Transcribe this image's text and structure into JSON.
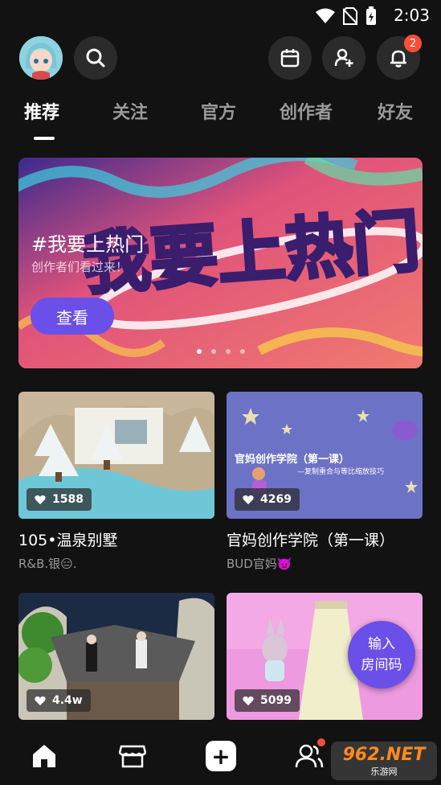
{
  "status_bar": {
    "time": "2:03"
  },
  "header": {
    "notification_count": "2"
  },
  "tabs": [
    {
      "label": "推荐",
      "active": true
    },
    {
      "label": "关注",
      "active": false
    },
    {
      "label": "官方",
      "active": false
    },
    {
      "label": "创作者",
      "active": false
    },
    {
      "label": "好友",
      "active": false
    }
  ],
  "banner": {
    "title": "#我要上热门",
    "subtitle": "创作者们看过来！",
    "button_label": "查看",
    "art_text": "我要上热门",
    "page_count": 4,
    "active_page": 1
  },
  "cards": [
    {
      "title": "105•温泉别墅",
      "author": "R&B.银😑.",
      "likes": "1588"
    },
    {
      "title": "官妈创作学院（第一课）",
      "author": "BUD官妈👿",
      "likes": "4269",
      "thumb_title": "官妈创作学院（第一课）",
      "thumb_subtitle": "—复制重合与等比缩放技巧"
    },
    {
      "title": "",
      "author": "",
      "likes": "4.4w"
    },
    {
      "title": "",
      "author": "",
      "likes": "5099"
    }
  ],
  "room_button": {
    "line1": "输入",
    "line2": "房间码"
  },
  "watermark": {
    "main": "962.NET",
    "sub": "乐游网"
  },
  "colors": {
    "accent": "#6a4fe8",
    "badge": "#ff4d3a",
    "background": "#121212"
  }
}
